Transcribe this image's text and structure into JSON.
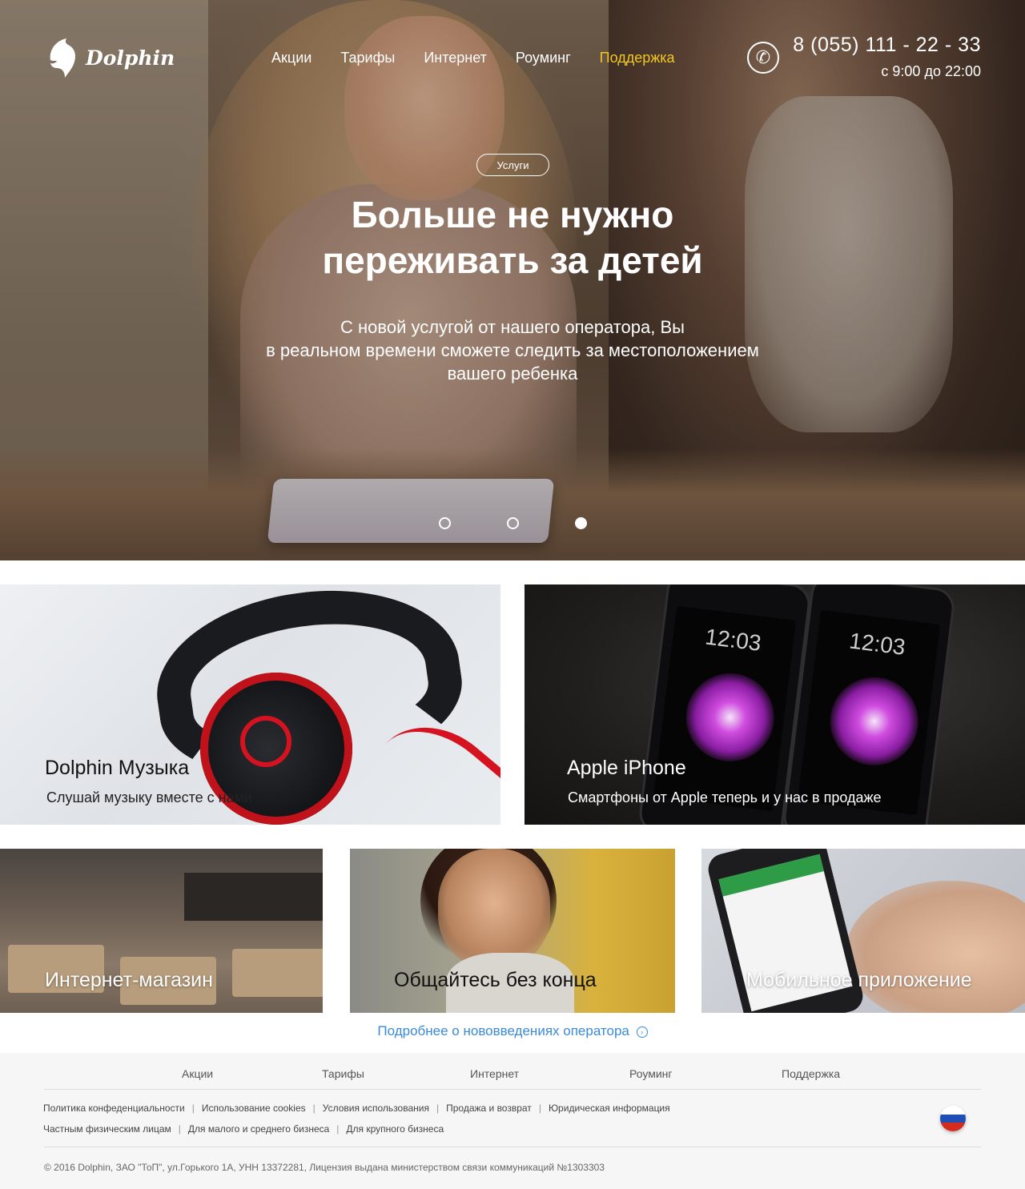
{
  "header": {
    "logo_text": "Dolphin",
    "nav": [
      "Акции",
      "Тарифы",
      "Интернет",
      "Роуминг",
      "Поддержка"
    ],
    "active_nav": "Поддержка",
    "phone": "8 (055) 111 - 22 - 33",
    "hours": "с 9:00 до 22:00",
    "phone_icon": "phone-icon"
  },
  "hero": {
    "badge": "Услуги",
    "title_line1": "Больше не нужно",
    "title_line2": "переживать за детей",
    "text_line1": "С новой услугой от нашего оператора, Вы",
    "text_line2": "в реальном времени сможете следить за местоположением",
    "text_line3": "вашего ребенка",
    "slides_total": 3,
    "active_slide": 3
  },
  "tiles": {
    "music": {
      "title": "Dolphin Музыка",
      "subtitle": "Слушай музыку вместе с нами"
    },
    "iphone": {
      "title": "Apple iPhone",
      "subtitle": "Смартфоны от Apple теперь и у нас в продаже",
      "clock": "12:03"
    },
    "shop": {
      "title": "Интернет-магазин"
    },
    "talk": {
      "title": "Общайтесь без конца"
    },
    "app": {
      "title": "Мобильное приложение"
    }
  },
  "more_link": "Подробнее о нововведениях оператора",
  "footer": {
    "nav": [
      "Акции",
      "Тарифы",
      "Интернет",
      "Роуминг",
      "Поддержка"
    ],
    "links_row1": [
      "Политика конфеденциальности",
      "Использование cookies",
      "Условия использования",
      "Продажа и возврат",
      "Юридическая информация"
    ],
    "links_row2": [
      "Частным физическим лицам",
      "Для малого и среднего бизнеса",
      "Для крупного бизнеса"
    ],
    "copyright": "© 2016 Dolphin, ЗАО \"ТоП\", ул.Горького 1А, УНН 13372281, Лицензия выдана министерством связи коммуникаций №1303303",
    "flag_colors": [
      "#ffffff",
      "#1f4fb5",
      "#d52b1e"
    ]
  },
  "colors": {
    "accent": "#f3c623",
    "link": "#3c8ad8"
  }
}
